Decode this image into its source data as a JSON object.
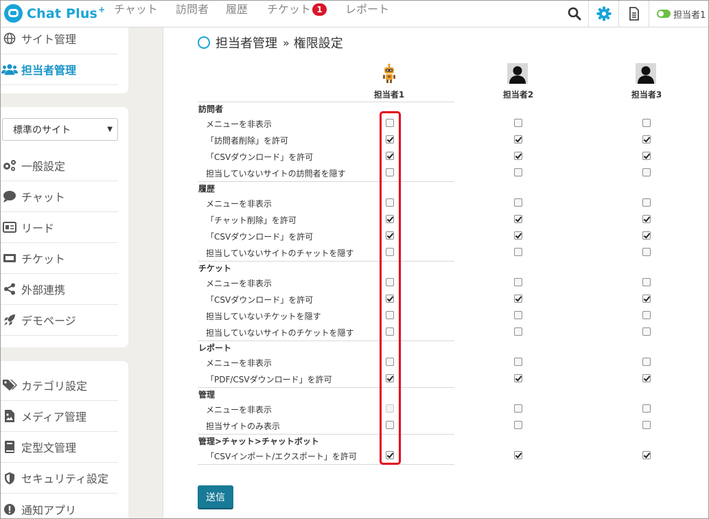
{
  "brand": {
    "name": "Chat Plus",
    "mark": "+"
  },
  "nav": {
    "chat": "チャット",
    "visitors": "訪問者",
    "history": "履歴",
    "ticket": "チケット",
    "ticket_badge": "1",
    "report": "レポート"
  },
  "topbar": {
    "search_icon": "search-icon",
    "settings_icon": "gear-icon",
    "doc_icon": "document-icon",
    "user_label": "担当者1"
  },
  "sidebar": {
    "top": [
      {
        "label": "サイト管理",
        "icon": "globe-icon"
      },
      {
        "label": "担当者管理",
        "icon": "users-icon"
      }
    ],
    "site_select": "標準のサイト",
    "mid": [
      {
        "label": "一般設定",
        "icon": "gears-icon"
      },
      {
        "label": "チャット",
        "icon": "chat-bubble-icon"
      },
      {
        "label": "リード",
        "icon": "id-card-icon"
      },
      {
        "label": "チケット",
        "icon": "ticket-icon"
      },
      {
        "label": "外部連携",
        "icon": "share-icon"
      },
      {
        "label": "デモページ",
        "icon": "rocket-icon"
      }
    ],
    "bottom": [
      {
        "label": "カテゴリ設定",
        "icon": "tags-icon"
      },
      {
        "label": "メディア管理",
        "icon": "image-file-icon"
      },
      {
        "label": "定型文管理",
        "icon": "book-icon"
      },
      {
        "label": "セキュリティ設定",
        "icon": "shield-icon"
      },
      {
        "label": "通知アプリ",
        "icon": "exclamation-icon"
      }
    ]
  },
  "page": {
    "title_prefix": "担当者管理",
    "separator": "»",
    "title": "権限設定"
  },
  "agents": [
    "担当者1",
    "担当者2",
    "担当者3"
  ],
  "sections": [
    {
      "title": "訪問者",
      "rows": [
        {
          "label": "メニューを非表示",
          "checks": [
            false,
            false,
            false
          ]
        },
        {
          "label": "「訪問者削除」を許可",
          "checks": [
            true,
            true,
            true
          ]
        },
        {
          "label": "「CSVダウンロード」を許可",
          "checks": [
            true,
            true,
            true
          ]
        },
        {
          "label": "担当していないサイトの訪問者を隠す",
          "checks": [
            false,
            false,
            false
          ]
        }
      ]
    },
    {
      "title": "履歴",
      "rows": [
        {
          "label": "メニューを非表示",
          "checks": [
            false,
            false,
            false
          ]
        },
        {
          "label": "「チャット削除」を許可",
          "checks": [
            true,
            true,
            true
          ]
        },
        {
          "label": "「CSVダウンロード」を許可",
          "checks": [
            true,
            true,
            true
          ]
        },
        {
          "label": "担当していないサイトのチャットを隠す",
          "checks": [
            false,
            false,
            false
          ]
        }
      ]
    },
    {
      "title": "チケット",
      "rows": [
        {
          "label": "メニューを非表示",
          "checks": [
            false,
            false,
            false
          ]
        },
        {
          "label": "「CSVダウンロード」を許可",
          "checks": [
            true,
            true,
            true
          ]
        },
        {
          "label": "担当していないチケットを隠す",
          "checks": [
            false,
            false,
            false
          ]
        },
        {
          "label": "担当していないサイトのチケットを隠す",
          "checks": [
            false,
            false,
            false
          ]
        }
      ]
    },
    {
      "title": "レポート",
      "rows": [
        {
          "label": "メニューを非表示",
          "checks": [
            false,
            false,
            false
          ]
        },
        {
          "label": "「PDF/CSVダウンロード」を許可",
          "checks": [
            true,
            true,
            true
          ]
        }
      ]
    },
    {
      "title": "管理",
      "rows": [
        {
          "label": "メニューを非表示",
          "checks": [
            false,
            false,
            false
          ],
          "disabled": [
            true,
            false,
            false
          ]
        },
        {
          "label": "担当サイトのみ表示",
          "checks": [
            false,
            false,
            false
          ]
        }
      ]
    },
    {
      "title": "管理>チャット>チャットボット",
      "rows": [
        {
          "label": "「CSVインポート/エクスポート」を許可",
          "checks": [
            true,
            true,
            true
          ]
        }
      ]
    }
  ],
  "submit_label": "送信",
  "colors": {
    "brand": "#1aa4d8",
    "highlight": "#e3001b",
    "submit": "#177a96",
    "badge": "#d9162a"
  }
}
